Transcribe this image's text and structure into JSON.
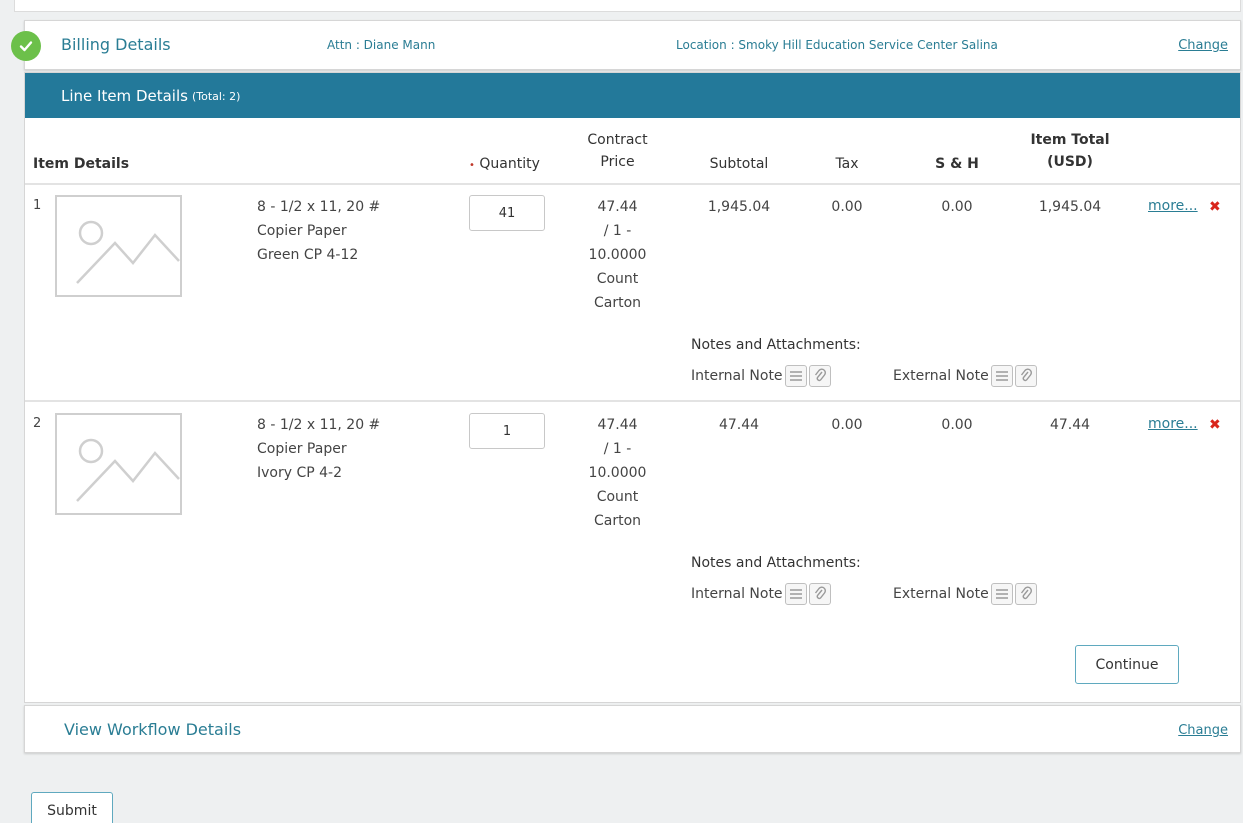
{
  "billing": {
    "title": "Billing Details",
    "attn": "Attn : Diane Mann",
    "location": "Location : Smoky Hill Education Service Center Salina",
    "change_label": "Change"
  },
  "line_items": {
    "header_title": "Line Item Details",
    "header_total": "(Total: 2)",
    "columns": {
      "item_details": "Item Details",
      "quantity_req": "•",
      "quantity": "Quantity",
      "contract_price_1": "Contract",
      "contract_price_2": "Price",
      "subtotal": "Subtotal",
      "tax": "Tax",
      "sh": "S & H",
      "item_total_1": "Item Total",
      "item_total_2": "(USD)"
    },
    "rows": [
      {
        "num": "1",
        "desc_1": "8 - 1/2 x 11, 20 #",
        "desc_2": "Copier Paper",
        "desc_3": "Green CP 4-12",
        "quantity": "41",
        "price_1": "47.44",
        "price_2": "/ 1 -",
        "price_3": "10.0000",
        "price_4": "Count",
        "price_5": "Carton",
        "subtotal": "1,945.04",
        "tax": "0.00",
        "sh": "0.00",
        "item_total": "1,945.04",
        "more_label": "more...",
        "delete_glyph": "✖"
      },
      {
        "num": "2",
        "desc_1": "8 - 1/2 x 11, 20 #",
        "desc_2": "Copier Paper",
        "desc_3": "Ivory CP 4-2",
        "quantity": "1",
        "price_1": "47.44",
        "price_2": "/ 1 -",
        "price_3": "10.0000",
        "price_4": "Count",
        "price_5": "Carton",
        "subtotal": "47.44",
        "tax": "0.00",
        "sh": "0.00",
        "item_total": "47.44",
        "more_label": "more...",
        "delete_glyph": "✖"
      }
    ],
    "notes": {
      "title": "Notes and Attachments:",
      "internal": "Internal Note",
      "external": "External Note"
    },
    "continue_label": "Continue"
  },
  "workflow": {
    "title": "View Workflow Details",
    "change_label": "Change"
  },
  "submit_label": "Submit",
  "colors": {
    "accent": "#23799a",
    "link": "#2a7d94",
    "success": "#6cc04a",
    "danger": "#d9261c"
  },
  "icons": [
    "check-icon",
    "image-placeholder-icon",
    "note-icon",
    "paperclip-icon",
    "delete-icon"
  ]
}
